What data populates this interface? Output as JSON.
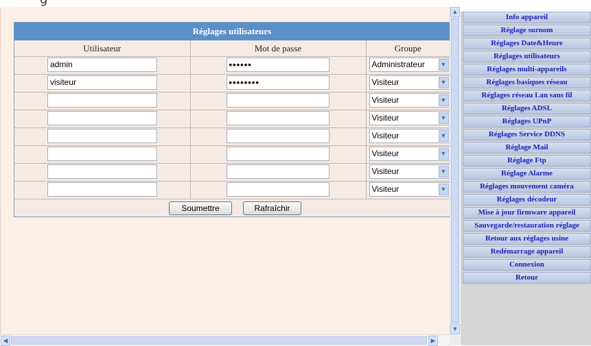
{
  "window": {
    "title_fragment": "g"
  },
  "panel": {
    "title": "Réglages utilisateurs",
    "columns": [
      "Utilisateur",
      "Mot de passe",
      "Groupe"
    ],
    "rows": [
      {
        "user": "admin",
        "password": "••••••",
        "group": "Administrateur"
      },
      {
        "user": "visiteur",
        "password": "••••••••",
        "group": "Visiteur"
      },
      {
        "user": "",
        "password": "",
        "group": "Visiteur"
      },
      {
        "user": "",
        "password": "",
        "group": "Visiteur"
      },
      {
        "user": "",
        "password": "",
        "group": "Visiteur"
      },
      {
        "user": "",
        "password": "",
        "group": "Visiteur"
      },
      {
        "user": "",
        "password": "",
        "group": "Visiteur"
      },
      {
        "user": "",
        "password": "",
        "group": "Visiteur"
      }
    ],
    "submit_label": "Soumettre",
    "refresh_label": "Rafraîchir"
  },
  "menu": {
    "items": [
      "Info appareil",
      "Réglage surnom",
      "Réglages Date&Heure",
      "Réglages utilisateurs",
      "Réglages multi-appareils",
      "Réglages basiques réseau",
      "Réglages réseau Lan sans fil",
      "Réglages ADSL",
      "Réglages UPnP",
      "Réglages Service DDNS",
      "Réglage Mail",
      "Réglage Ftp",
      "Réglage Alarme",
      "Réglages mouvement caméra",
      "Réglages décodeur",
      "Mise à jour firmware appareil",
      "Sauvegarde/restauration réglage",
      "Retour aux réglages usine",
      "Redémarrage appareil",
      "Connexion",
      "Retour"
    ]
  },
  "colors": {
    "panel_header": "#5b8fc7",
    "menu_text": "#1d1fb1",
    "page_bg": "#fcefe6"
  },
  "icons": {
    "select_arrow": "chevron-down-icon",
    "scroll_up": "arrow-up-icon",
    "scroll_down": "arrow-down-icon",
    "scroll_left": "arrow-left-icon",
    "scroll_right": "arrow-right-icon"
  }
}
